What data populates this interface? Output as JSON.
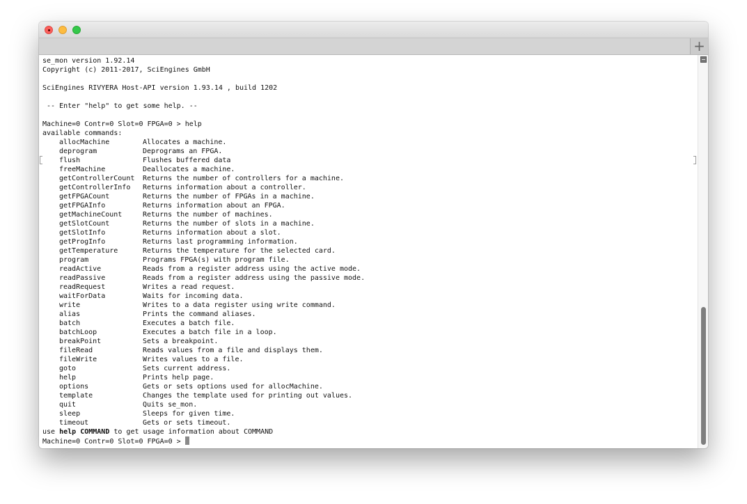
{
  "window": {
    "traffic_lights": [
      "close",
      "minimize",
      "zoom"
    ],
    "new_tab_icon": "plus-icon",
    "split_pane_icon": "split-pane-icon"
  },
  "terminal": {
    "header_lines": [
      "se_mon version 1.92.14",
      "Copyright (c) 2011-2017, SciEngines GmbH",
      "",
      "SciEngines RIVYERA Host-API version 1.93.14 , build 1202",
      "",
      " -- Enter \"help\" to get some help. --",
      ""
    ],
    "prompt": "Machine=0 Contr=0 Slot=0 FPGA=0 > ",
    "entered_command": "help",
    "available_label": "available commands:",
    "commands": [
      {
        "name": "allocMachine",
        "desc": "Allocates a machine."
      },
      {
        "name": "deprogram",
        "desc": "Deprograms an FPGA."
      },
      {
        "name": "flush",
        "desc": "Flushes buffered data"
      },
      {
        "name": "freeMachine",
        "desc": "Deallocates a machine."
      },
      {
        "name": "getControllerCount",
        "desc": "Returns the number of controllers for a machine."
      },
      {
        "name": "getControllerInfo",
        "desc": "Returns information about a controller."
      },
      {
        "name": "getFPGACount",
        "desc": "Returns the number of FPGAs in a machine."
      },
      {
        "name": "getFPGAInfo",
        "desc": "Returns information about an FPGA."
      },
      {
        "name": "getMachineCount",
        "desc": "Returns the number of machines."
      },
      {
        "name": "getSlotCount",
        "desc": "Returns the number of slots in a machine."
      },
      {
        "name": "getSlotInfo",
        "desc": "Returns information about a slot."
      },
      {
        "name": "getProgInfo",
        "desc": "Returns last programming information."
      },
      {
        "name": "getTemperature",
        "desc": "Returns the temperature for the selected card."
      },
      {
        "name": "program",
        "desc": "Programs FPGA(s) with program file."
      },
      {
        "name": "readActive",
        "desc": "Reads from a register address using the active mode."
      },
      {
        "name": "readPassive",
        "desc": "Reads from a register address using the passive mode."
      },
      {
        "name": "readRequest",
        "desc": "Writes a read request."
      },
      {
        "name": "waitForData",
        "desc": "Waits for incoming data."
      },
      {
        "name": "write",
        "desc": "Writes to a data register using write command."
      },
      {
        "name": "alias",
        "desc": "Prints the command aliases."
      },
      {
        "name": "batch",
        "desc": "Executes a batch file."
      },
      {
        "name": "batchLoop",
        "desc": "Executes a batch file in a loop."
      },
      {
        "name": "breakPoint",
        "desc": "Sets a breakpoint."
      },
      {
        "name": "fileRead",
        "desc": "Reads values from a file and displays them."
      },
      {
        "name": "fileWrite",
        "desc": "Writes values to a file."
      },
      {
        "name": "goto",
        "desc": "Sets current address."
      },
      {
        "name": "help",
        "desc": "Prints help page."
      },
      {
        "name": "options",
        "desc": "Gets or sets options used for allocMachine."
      },
      {
        "name": "template",
        "desc": "Changes the template used for printing out values."
      },
      {
        "name": "quit",
        "desc": "Quits se_mon."
      },
      {
        "name": "sleep",
        "desc": "Sleeps for given time."
      },
      {
        "name": "timeout",
        "desc": "Gets or sets timeout."
      }
    ],
    "usage_pre": "use ",
    "usage_bold": "help COMMAND",
    "usage_post": " to get usage information about COMMAND",
    "final_prompt": "Machine=0 Contr=0 Slot=0 FPGA=0 > "
  }
}
